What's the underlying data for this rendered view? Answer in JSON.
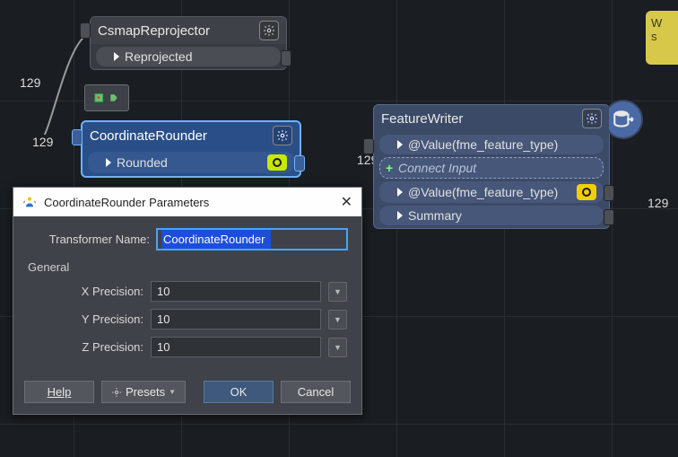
{
  "nodes": {
    "csmap": {
      "title": "CsmapReprojector",
      "port_out": "Reprojected"
    },
    "coord": {
      "title": "CoordinateRounder",
      "port_out": "Rounded"
    },
    "fw": {
      "title": "FeatureWriter",
      "port_in": "@Value(fme_feature_type)",
      "connect": "Connect Input",
      "port_out1": "@Value(fme_feature_type)",
      "port_out2": "Summary"
    }
  },
  "counts": {
    "c1": "129",
    "c2": "129",
    "c3": "129",
    "c4": "129"
  },
  "toast": {
    "line1": "W",
    "line2": "s"
  },
  "dialog": {
    "title": "CoordinateRounder Parameters",
    "name_label": "Transformer Name:",
    "name_value": "CoordinateRounder",
    "section": "General",
    "x_label": "X Precision:",
    "x_value": "10",
    "y_label": "Y Precision:",
    "y_value": "10",
    "z_label": "Z Precision:",
    "z_value": "10",
    "help": "Help",
    "presets": "Presets",
    "ok": "OK",
    "cancel": "Cancel"
  }
}
